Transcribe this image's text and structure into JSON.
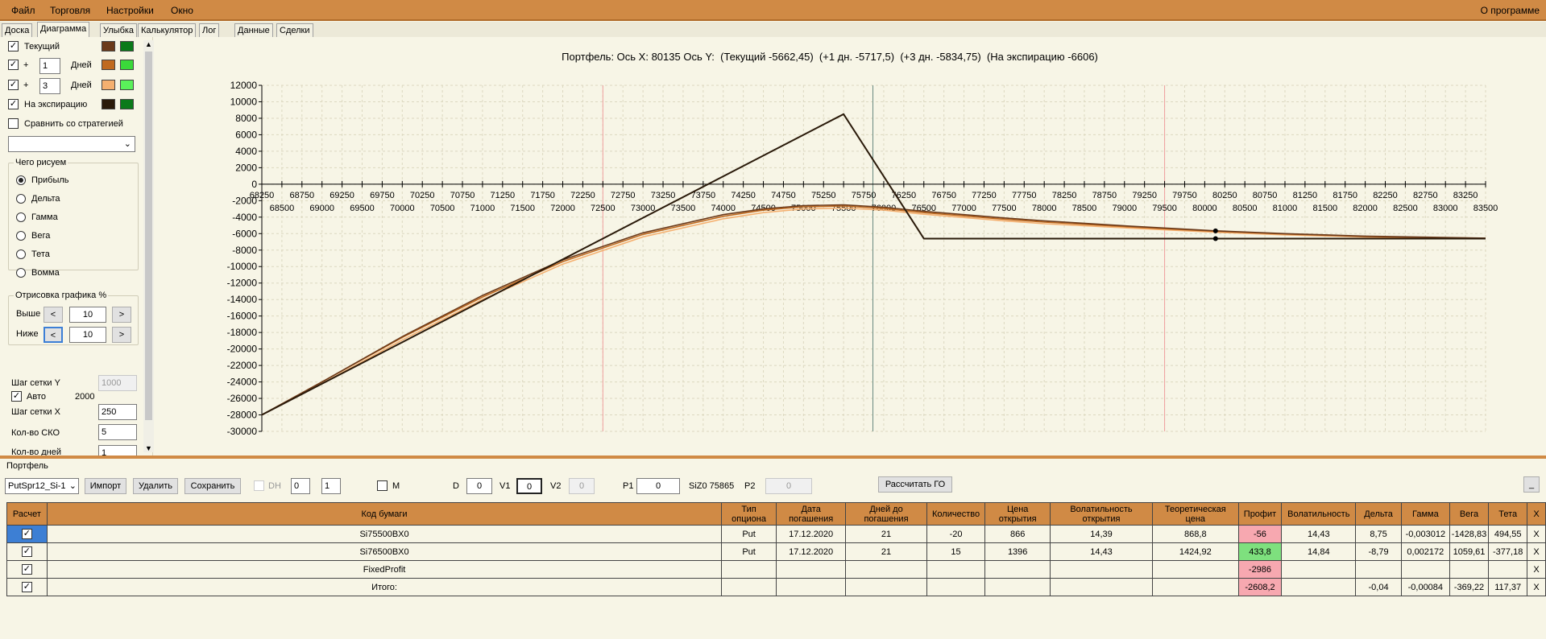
{
  "menu": {
    "file": "Файл",
    "trading": "Торговля",
    "settings": "Настройки",
    "window": "Окно",
    "about": "О программе"
  },
  "tabs": [
    "Доска",
    "Диаграмма",
    "Улыбка",
    "Калькулятор",
    "Лог",
    "Данные",
    "Сделки"
  ],
  "left": {
    "current_label": "Текущий",
    "plus": "+",
    "days_label": "Дней",
    "days1": "1",
    "days2": "3",
    "expiration_label": "На экспирацию",
    "compare_label": "Сравнить со стратегией",
    "what_title": "Чего рисуем",
    "radios": [
      "Прибыль",
      "Дельта",
      "Гамма",
      "Вега",
      "Тета",
      "Вомма"
    ],
    "render_title": "Отрисовка графика %",
    "above_label": "Выше",
    "below_label": "Ниже",
    "above_val": "10",
    "below_val": "10",
    "prev": "<",
    "next": ">",
    "grid_y_label": "Шаг сетки Y",
    "grid_y_val": "1000",
    "auto_label": "Авто",
    "auto_val": "2000",
    "grid_x_label": "Шаг сетки X",
    "grid_x_val": "250",
    "sko_label": "Кол-во СКО",
    "sko_val": "5",
    "days_count_label": "Кол-во дней",
    "days_count_val": "1",
    "swatches": {
      "cur1": "#6b3a1a",
      "cur2": "#0a7a1a",
      "d1a": "#c06a20",
      "d1b": "#3ad83a",
      "d3a": "#f5b070",
      "d3b": "#5af05a",
      "exp1": "#2a1a0a",
      "exp2": "#0a7a1a"
    }
  },
  "chart_title": "Портфель: Ось X: 80135 Ось Y:  (Текущий -5662,45)  (+1 дн. -5717,5)  (+3 дн. -5834,75)  (На экспирацию -6606)",
  "chart_data": {
    "type": "line",
    "xlim": [
      68250,
      83500
    ],
    "ylim": [
      -30000,
      12000
    ],
    "yticks": [
      12000,
      10000,
      8000,
      6000,
      4000,
      2000,
      0,
      -2000,
      -4000,
      -6000,
      -8000,
      -10000,
      -12000,
      -14000,
      -16000,
      -18000,
      -20000,
      -22000,
      -24000,
      -26000,
      -28000,
      -30000
    ],
    "xticks_upper": [
      68250,
      68750,
      69250,
      69750,
      70250,
      70750,
      71250,
      71750,
      72250,
      72750,
      73250,
      73750,
      74250,
      74750,
      75250,
      75750,
      76250,
      76750,
      77250,
      77750,
      78250,
      78750,
      79250,
      79750,
      80250,
      80750,
      81250,
      81750,
      82250,
      82750,
      83250
    ],
    "xticks_lower": [
      68500,
      69000,
      69500,
      70000,
      70500,
      71000,
      71500,
      72000,
      72500,
      73000,
      73500,
      74000,
      74500,
      75000,
      75500,
      76000,
      76500,
      77000,
      77500,
      78000,
      78500,
      79000,
      79500,
      80000,
      80500,
      81000,
      81500,
      82000,
      82500,
      83000,
      83500
    ],
    "vlines_red": [
      72500,
      79500
    ],
    "vline_current": 75865,
    "cursor_x": 80135,
    "series": [
      {
        "name": "На экспирацию",
        "color": "#2a1a0a",
        "x": [
          68250,
          75500,
          76500,
          83500
        ],
        "y": [
          -28000,
          8500,
          -6606,
          -6606
        ]
      },
      {
        "name": "Текущий",
        "color": "#6b3a1a",
        "x": [
          68250,
          69000,
          70000,
          71000,
          72000,
          73000,
          74000,
          74500,
          75000,
          75500,
          76000,
          76500,
          77000,
          77500,
          78000,
          79000,
          80135,
          81000,
          82000,
          83500
        ],
        "y": [
          -28000,
          -24000,
          -18500,
          -13500,
          -9200,
          -5900,
          -3700,
          -3000,
          -2600,
          -2500,
          -2800,
          -3300,
          -3700,
          -4100,
          -4450,
          -5050,
          -5662,
          -6000,
          -6300,
          -6550
        ]
      },
      {
        "name": "+1 дн.",
        "color": "#c06a20",
        "x": [
          68250,
          69000,
          70000,
          71000,
          72000,
          73000,
          74000,
          74500,
          75000,
          75500,
          76000,
          76500,
          77000,
          77500,
          78000,
          79000,
          80135,
          81000,
          82000,
          83500
        ],
        "y": [
          -28000,
          -24000,
          -18600,
          -13700,
          -9400,
          -6100,
          -3900,
          -3150,
          -2750,
          -2650,
          -2950,
          -3450,
          -3850,
          -4250,
          -4600,
          -5150,
          -5717,
          -6050,
          -6350,
          -6570
        ]
      },
      {
        "name": "+3 дн.",
        "color": "#f5b070",
        "x": [
          68250,
          69000,
          70000,
          71000,
          72000,
          73000,
          74000,
          74500,
          75000,
          75500,
          76000,
          76500,
          77000,
          77500,
          78000,
          79000,
          80135,
          81000,
          82000,
          83500
        ],
        "y": [
          -28000,
          -24200,
          -18900,
          -14000,
          -9700,
          -6400,
          -4200,
          -3450,
          -3000,
          -2900,
          -3150,
          -3650,
          -4050,
          -4450,
          -4800,
          -5300,
          -5835,
          -6150,
          -6400,
          -6590
        ]
      }
    ],
    "grid": true
  },
  "bottom": {
    "portfolio_label": "Портфель",
    "portfolio_select": "PutSpr12_Si-1",
    "import": "Импорт",
    "delete": "Удалить",
    "save": "Сохранить",
    "dh": "DH",
    "dh_v1": "0",
    "dh_v2": "1",
    "m": "M",
    "d_label": "D",
    "d_val": "0",
    "v1_label": "V1",
    "v1_val": "0",
    "v2_label": "V2",
    "v2_val": "0",
    "p1_label": "P1",
    "p1_val": "0",
    "underlying": "SiZ0 75865",
    "p2_label": "P2",
    "p2_val": "0",
    "calc_go": "Рассчитать ГО",
    "minimize": "_"
  },
  "table": {
    "headers": [
      "Расчет",
      "Код бумаги",
      "Тип опциона",
      "Дата погашения",
      "Дней до погашения",
      "Количество",
      "Цена открытия",
      "Волатильность открытия",
      "Теоретическая цена",
      "Профит",
      "Волатильность",
      "Дельта",
      "Гамма",
      "Вега",
      "Тета",
      "X"
    ],
    "rows": [
      [
        "",
        "Si75500BX0",
        "Put",
        "17.12.2020",
        "21",
        "-20",
        "866",
        "14,39",
        "868,8",
        "-56",
        "14,43",
        "8,75",
        "-0,003012",
        "-1428,83",
        "494,55",
        "X"
      ],
      [
        "",
        "Si76500BX0",
        "Put",
        "17.12.2020",
        "21",
        "15",
        "1396",
        "14,43",
        "1424,92",
        "433,8",
        "14,84",
        "-8,79",
        "0,002172",
        "1059,61",
        "-377,18",
        "X"
      ],
      [
        "",
        "FixedProfit",
        "",
        "",
        "",
        "",
        "",
        "",
        "",
        "-2986",
        "",
        "",
        "",
        "",
        "",
        "X"
      ],
      [
        "",
        "Итого:",
        "",
        "",
        "",
        "",
        "",
        "",
        "",
        "-2608,2",
        "",
        "-0,04",
        "-0,00084",
        "-369,22",
        "117,37",
        "X"
      ]
    ]
  }
}
